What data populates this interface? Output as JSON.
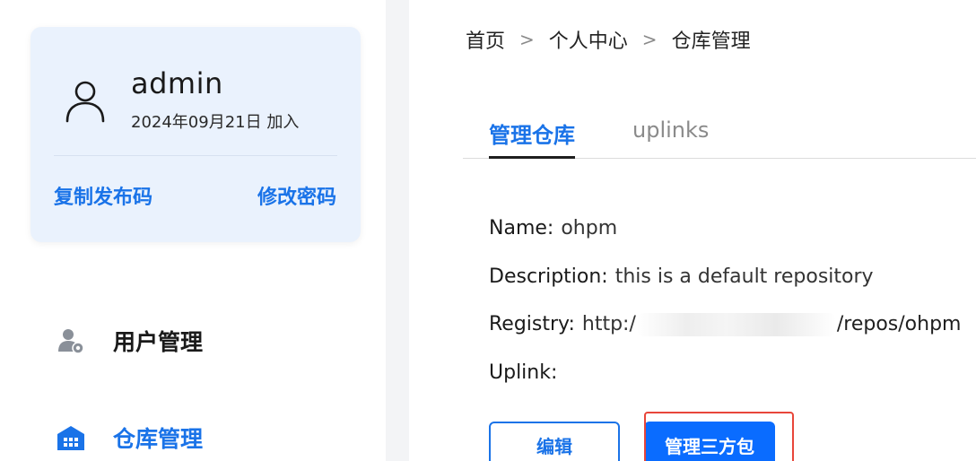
{
  "user_card": {
    "username": "admin",
    "joined": "2024年09月21日 加入",
    "copy_link": "复制发布码",
    "change_password_link": "修改密码"
  },
  "nav": {
    "items": [
      {
        "label": "用户管理",
        "icon": "user-gear-icon",
        "active": false
      },
      {
        "label": "仓库管理",
        "icon": "warehouse-icon",
        "active": true
      }
    ]
  },
  "breadcrumb": {
    "items": [
      "首页",
      "个人中心",
      "仓库管理"
    ],
    "separator": ">"
  },
  "tabs": [
    {
      "label": "管理仓库",
      "active": true
    },
    {
      "label": "uplinks",
      "active": false
    }
  ],
  "repo": {
    "name_label": "Name:",
    "name_value": "ohpm",
    "description_label": "Description:",
    "description_value": "this is a default repository",
    "registry_label": "Registry:",
    "registry_prefix": "http:/",
    "registry_suffix": "/repos/ohpm",
    "uplink_label": "Uplink:",
    "uplink_value": ""
  },
  "actions": {
    "edit_label": "编辑",
    "manage_label": "管理三方包"
  },
  "colors": {
    "accent": "#1a73e8",
    "card_bg": "#eaf2fd",
    "primary_button": "#0a6cff",
    "highlight": "#e8463a"
  }
}
